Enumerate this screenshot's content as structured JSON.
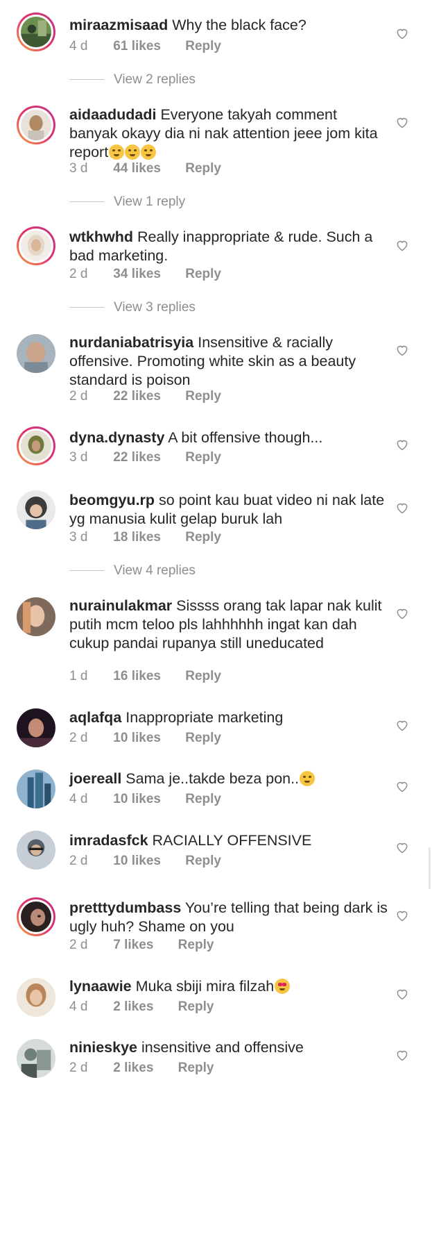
{
  "comments": [
    {
      "username": "miraazmisaad",
      "text": "Why the black face?",
      "time": "4 d",
      "likes": "61 likes",
      "reply": "Reply",
      "view_replies": "View 2 replies",
      "ring": true,
      "avatar_color": "#6b8f4e"
    },
    {
      "username": "aidaadudadi",
      "text": "Everyone takyah comment banyak okayy dia ni nak attention jeee jom kita report",
      "emoji_count": 3,
      "time": "3 d",
      "likes": "44 likes",
      "reply": "Reply",
      "view_replies": "View 1 reply",
      "ring": true,
      "avatar_color": "#b08a63"
    },
    {
      "username": "wtkhwhd",
      "text": "Really inappropriate & rude. Such a bad marketing.",
      "time": "2 d",
      "likes": "34 likes",
      "reply": "Reply",
      "view_replies": "View 3 replies",
      "ring": true,
      "avatar_color": "#d9c3b0"
    },
    {
      "username": "nurdaniabatrisyia",
      "text": "Insensitive & racially offensive. Promoting white skin as a beauty standard is poison",
      "time": "2 d",
      "likes": "22 likes",
      "reply": "Reply",
      "ring": false,
      "avatar_color": "#8e9aa6"
    },
    {
      "username": "dyna.dynasty",
      "text": "A bit offensive though...",
      "time": "3 d",
      "likes": "22 likes",
      "reply": "Reply",
      "ring": true,
      "avatar_color": "#6f7a3c"
    },
    {
      "username": "beomgyu.rp",
      "text": "so point kau buat video ni nak late yg manusia kulit gelap buruk lah",
      "time": "3 d",
      "likes": "18 likes",
      "reply": "Reply",
      "view_replies": "View 4 replies",
      "ring": false,
      "avatar_color": "#3b3b3b"
    },
    {
      "username": "nurainulakmar",
      "text": "Sissss orang tak lapar nak kulit putih mcm teloo pls lahhhhhh ingat kan dah cukup pandai rupanya still uneducated",
      "time": "1 d",
      "likes": "16 likes",
      "reply": "Reply",
      "ring": false,
      "avatar_color": "#c9a48a"
    },
    {
      "username": "aqlafqa",
      "text": "Inappropriate marketing",
      "time": "2 d",
      "likes": "10 likes",
      "reply": "Reply",
      "ring": false,
      "avatar_color": "#4a2a3a"
    },
    {
      "username": "joereall",
      "text": "Sama je..takde beza pon..",
      "emoji_count": 1,
      "time": "4 d",
      "likes": "10 likes",
      "reply": "Reply",
      "ring": false,
      "avatar_color": "#2f5f7f"
    },
    {
      "username": "imradasfck",
      "text": "RACIALLY OFFENSIVE",
      "time": "2 d",
      "likes": "10 likes",
      "reply": "Reply",
      "ring": false,
      "avatar_color": "#55606b"
    },
    {
      "username": "pretttydumbass",
      "text": "You’re telling that being dark is ugly huh? Shame on you",
      "time": "2 d",
      "likes": "7 likes",
      "reply": "Reply",
      "ring": true,
      "avatar_color": "#2b2020"
    },
    {
      "username": "lynaawie",
      "text": "Muka sbiji mira filzah",
      "emoji_count": 1,
      "emoji_type": "heart-eyes",
      "time": "4 d",
      "likes": "2 likes",
      "reply": "Reply",
      "ring": false,
      "avatar_color": "#d8b79a"
    },
    {
      "username": "ninieskye",
      "text": "insensitive and offensive",
      "time": "2 d",
      "likes": "2 likes",
      "reply": "Reply",
      "ring": false,
      "avatar_color": "#6f7f7a"
    }
  ],
  "icons": {
    "like": "heart-outline-icon"
  },
  "colors": {
    "text": "#262626",
    "muted": "#8e8e8e",
    "story_ring": "#e1306c"
  }
}
